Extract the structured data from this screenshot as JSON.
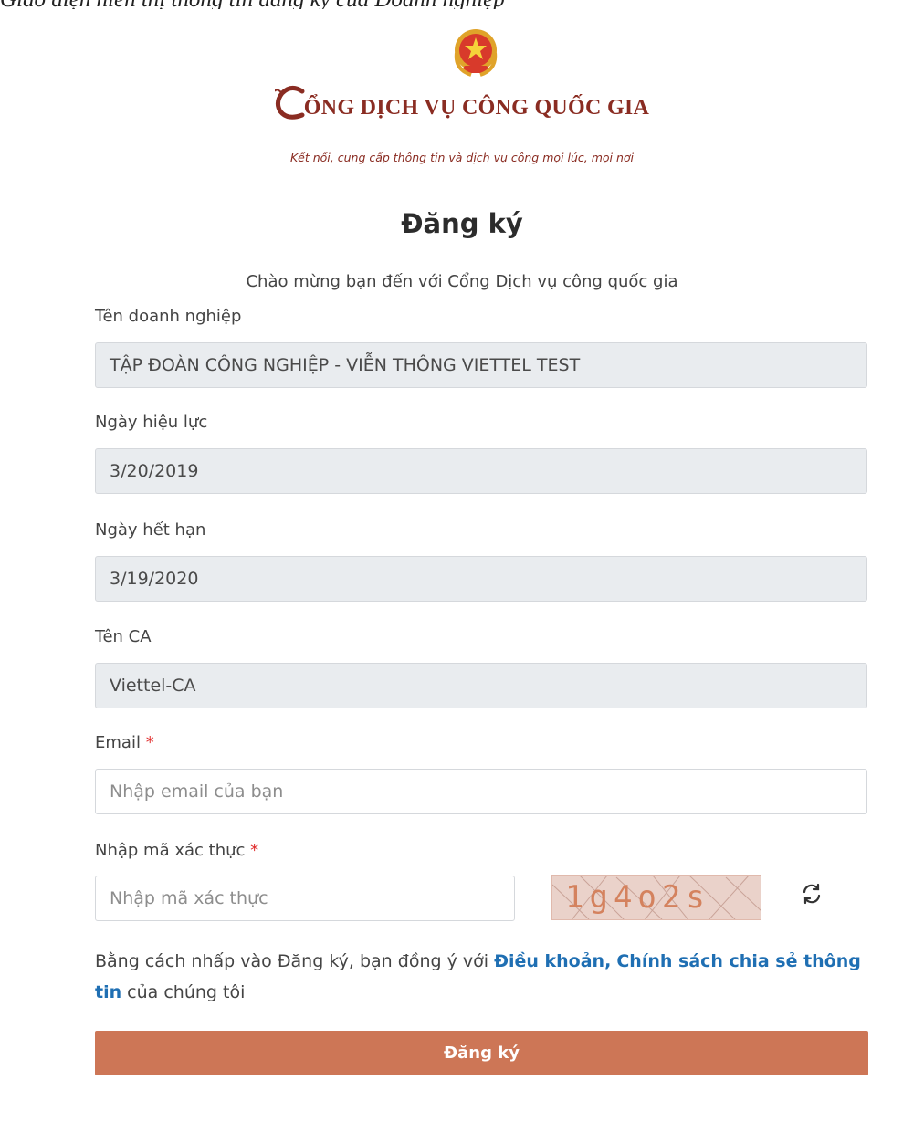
{
  "caption": "Giao diện hiển thị thông tin đăng ký của Doanh nghiệp",
  "header": {
    "brand": "CỔNG DỊCH VỤ CÔNG QUỐC GIA",
    "brand_rest": "ỔNG DỊCH VỤ CÔNG QUỐC GIA",
    "slogan": "Kết nối, cung cấp thông tin và dịch vụ công mọi lúc, mọi nơi",
    "emblem_icon": "national-emblem-icon",
    "colors": {
      "brand": "#8a2c22",
      "emblem": "#d83a2b"
    }
  },
  "form": {
    "title": "Đăng ký",
    "welcome": "Chào mừng bạn đến với Cổng Dịch vụ công quốc gia",
    "company": {
      "label": "Tên doanh nghiệp",
      "value": "TẬP ĐOÀN CÔNG NGHIỆP - VIỄN THÔNG VIETTEL TEST"
    },
    "start_date": {
      "label": "Ngày hiệu lực",
      "value": "3/20/2019"
    },
    "end_date": {
      "label": "Ngày hết hạn",
      "value": "3/19/2020"
    },
    "ca_name": {
      "label": "Tên CA",
      "value": "Viettel-CA"
    },
    "email": {
      "label": "Email",
      "required_mark": "*",
      "placeholder": "Nhập email của bạn"
    },
    "captcha": {
      "label": "Nhập mã xác thực",
      "required_mark": "*",
      "placeholder": "Nhập mã xác thực",
      "code": "1g4o2s",
      "refresh_icon": "refresh-icon"
    },
    "terms": {
      "prefix": "Bằng cách nhấp vào Đăng ký, bạn đồng ý với ",
      "link_terms": "Điều khoản,",
      "link_policy": "Chính sách chia sẻ thông tin",
      "suffix": " của chúng tôi"
    },
    "submit_label": "Đăng ký",
    "colors": {
      "submit": "#cd7656",
      "link": "#1f6fb3",
      "readonly_bg": "#e9ecef"
    }
  }
}
